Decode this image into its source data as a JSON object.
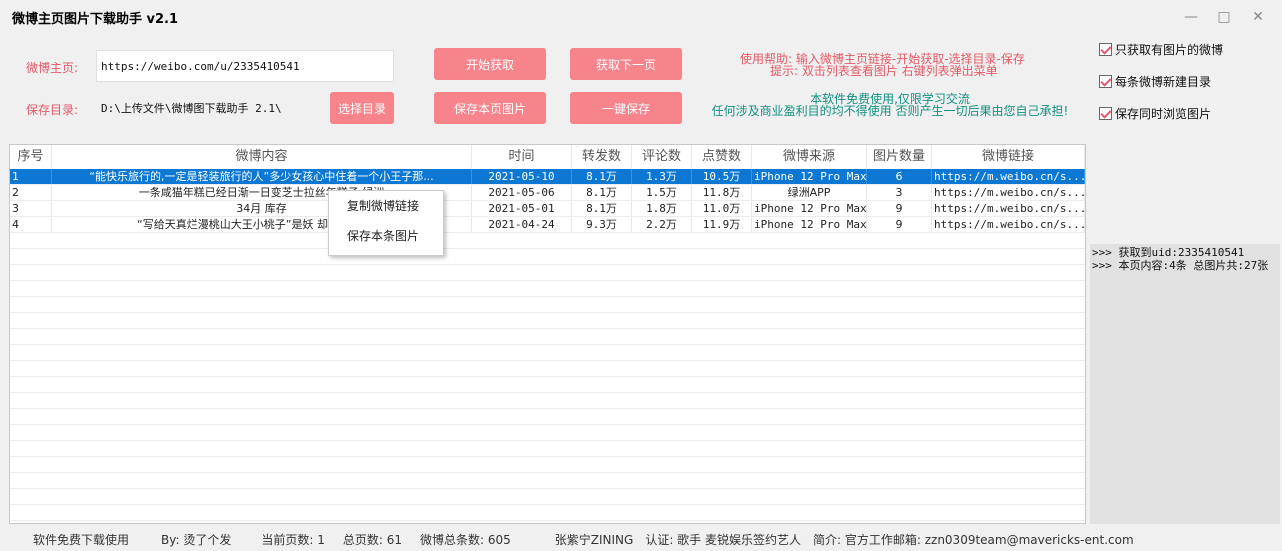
{
  "window": {
    "title": "微博主页图片下载助手 v2.1",
    "min_icon": "minimize-icon",
    "max_icon": "maximize-icon",
    "close_icon": "close-icon"
  },
  "form": {
    "homepage_label": "微博主页:",
    "homepage_value": "https://weibo.com/u/2335410541",
    "save_dir_label": "保存目录:",
    "save_dir_value": "D:\\上传文件\\微博图下载助手 2.1\\",
    "choose_dir_button": "选择目录"
  },
  "buttons": {
    "start_fetch": "开始获取",
    "next_page": "获取下一页",
    "save_page_images": "保存本页图片",
    "one_click_save": "一键保存"
  },
  "help": {
    "line1": "使用帮助: 输入微博主页链接-开始获取-选择目录-保存",
    "line2": "提示: 双击列表查看图片 右键列表弹出菜单"
  },
  "notice": {
    "line1": "本软件免费使用,仅限学习交流",
    "line2": "任何涉及商业盈利目的均不得使用 否则产生一切后果由您自己承担!"
  },
  "options": [
    {
      "label": "只获取有图片的微博",
      "checked": true
    },
    {
      "label": "每条微博新建目录",
      "checked": true
    },
    {
      "label": "保存同时浏览图片",
      "checked": true
    }
  ],
  "table": {
    "columns": [
      "序号",
      "微博内容",
      "时间",
      "转发数",
      "评论数",
      "点赞数",
      "微博来源",
      "图片数量",
      "微博链接"
    ],
    "rows": [
      {
        "idx": "1",
        "content": "“能快乐旅行的,一定是轻装旅行的人”多少女孩心中住着一个小王子那...",
        "time": "2021-05-10",
        "reposts": "8.1万",
        "comments": "1.3万",
        "likes": "10.5万",
        "source": "iPhone 12 Pro Max",
        "images": "6",
        "link": "https://m.weibo.cn/s...",
        "selected": true
      },
      {
        "idx": "2",
        "content": "一条咸猫年糕已经日渐一日变芝士拉丝年糕子 绿洲",
        "time": "2021-05-06",
        "reposts": "8.1万",
        "comments": "1.5万",
        "likes": "11.8万",
        "source": "绿洲APP",
        "images": "3",
        "link": "https://m.weibo.cn/s...",
        "selected": false
      },
      {
        "idx": "3",
        "content": "34月 库存",
        "time": "2021-05-01",
        "reposts": "8.1万",
        "comments": "1.8万",
        "likes": "11.0万",
        "source": "iPhone 12 Pro Max",
        "images": "9",
        "link": "https://m.weibo.cn/s...",
        "selected": false
      },
      {
        "idx": "4",
        "content": "“写给天真烂漫桃山大王小桃子”是妖 却充满人性 ...",
        "time": "2021-04-24",
        "reposts": "9.3万",
        "comments": "2.2万",
        "likes": "11.9万",
        "source": "iPhone 12 Pro Max",
        "images": "9",
        "link": "https://m.weibo.cn/s...",
        "selected": false
      }
    ]
  },
  "context_menu": {
    "copy_link": "复制微博链接",
    "save_images": "保存本条图片"
  },
  "log": {
    "line1": ">>> 获取到uid:2335410541",
    "line2": ">>> 本页内容:4条 总图片共:27张"
  },
  "status": {
    "free": "软件免费下载使用",
    "by": "By: 烫了个发",
    "current_page": "当前页数: 1",
    "total_pages": "总页数: 61",
    "total_weibo": "微博总条数: 605",
    "user_name": "张紫宁ZINING",
    "verify": "认证: 歌手 麦锐娱乐签约艺人",
    "bio": "简介: 官方工作邮箱: zzn0309team@mavericks-ent.com"
  },
  "colors": {
    "accent_pink": "#f7838b",
    "label_red": "#e35a68",
    "notice_green": "#10907f",
    "selection_blue": "#0c78d4"
  }
}
